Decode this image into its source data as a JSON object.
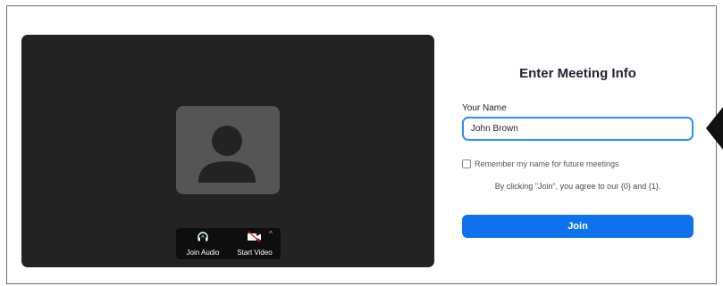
{
  "form": {
    "title": "Enter Meeting Info",
    "name_label": "Your Name",
    "name_value": "John Brown",
    "remember_label": "Remember my name for future meetings",
    "remember_checked": false,
    "agree_text": "By clicking \"Join\", you agree to our {0} and {1}.",
    "join_label": "Join"
  },
  "preview": {
    "audio_label": "Join Audio",
    "video_label": "Start Video",
    "caret": "^"
  },
  "colors": {
    "accent": "#0e72ed",
    "focus_border": "#2d8cff",
    "preview_bg": "#232323",
    "avatar_bg": "#555555",
    "muted_slash": "#e02828"
  },
  "icons": [
    "avatar-placeholder-icon",
    "headphones-icon",
    "video-off-icon",
    "caret-up-icon",
    "pointer-arrow-icon"
  ]
}
